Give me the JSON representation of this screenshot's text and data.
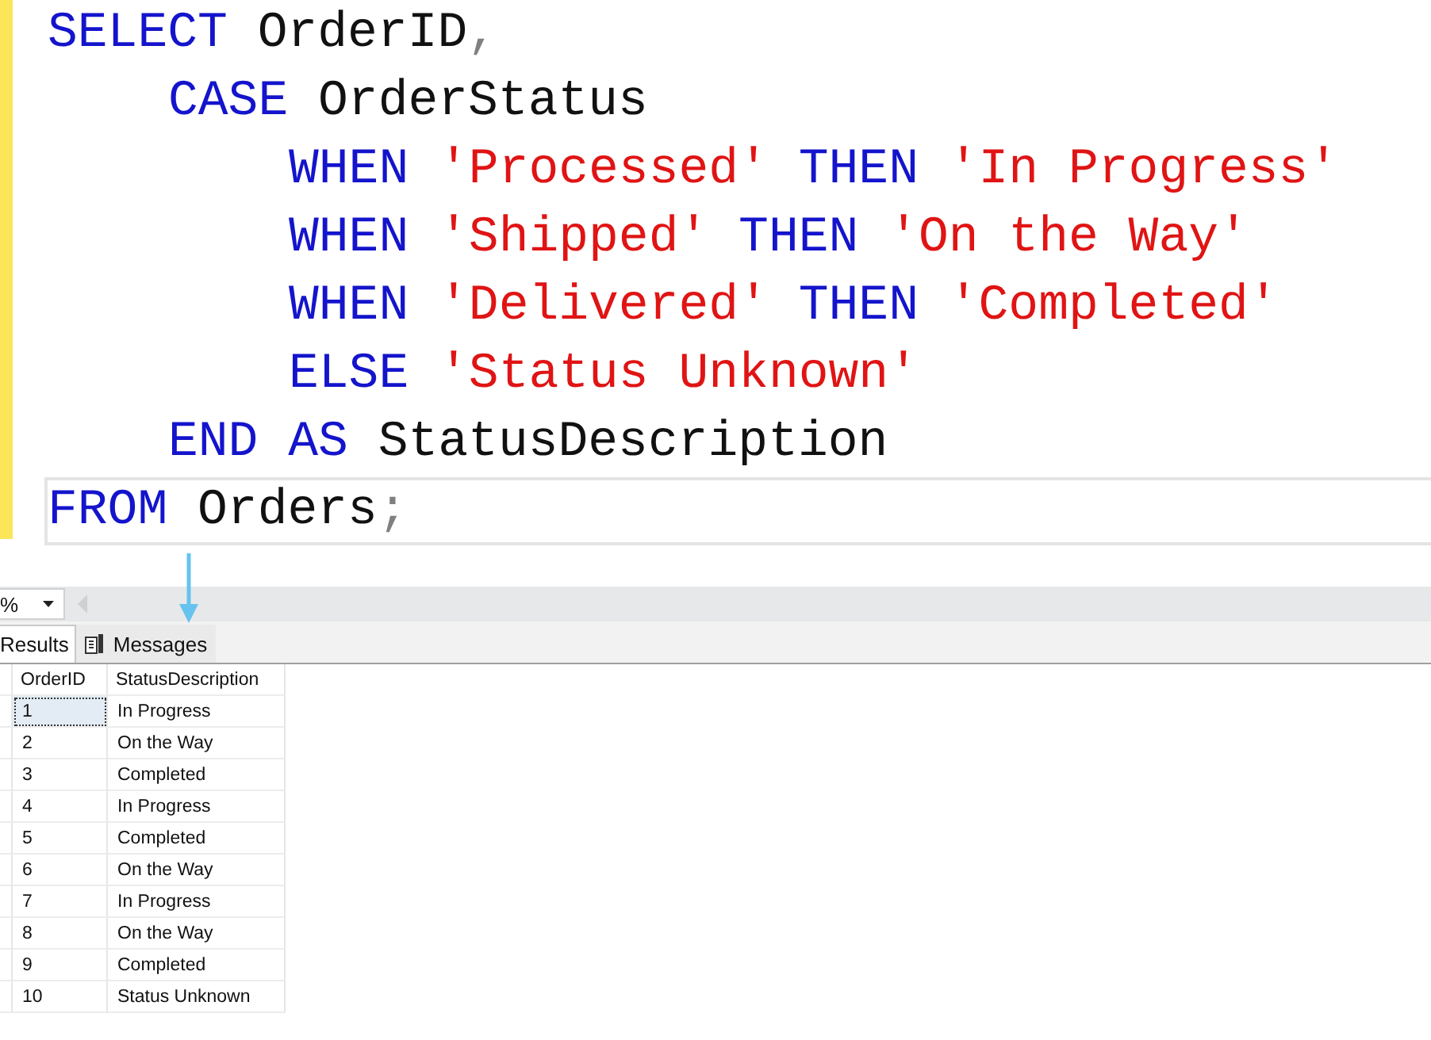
{
  "editor": {
    "lines": [
      {
        "current": false,
        "tokens": [
          {
            "kind": "keyword",
            "text": "SELECT "
          },
          {
            "kind": "plain",
            "text": "OrderID"
          },
          {
            "kind": "punct",
            "text": ","
          }
        ],
        "children": [
          {
            "current": false,
            "tokens": [
              {
                "kind": "keyword",
                "text": "CASE "
              },
              {
                "kind": "plain",
                "text": "OrderStatus"
              }
            ],
            "children": [
              {
                "current": false,
                "tokens": [
                  {
                    "kind": "keyword",
                    "text": "WHEN "
                  },
                  {
                    "kind": "string",
                    "text": "'Processed' "
                  },
                  {
                    "kind": "keyword",
                    "text": "THEN "
                  },
                  {
                    "kind": "string",
                    "text": "'In Progress'"
                  }
                ]
              },
              {
                "current": false,
                "tokens": [
                  {
                    "kind": "keyword",
                    "text": "WHEN "
                  },
                  {
                    "kind": "string",
                    "text": "'Shipped' "
                  },
                  {
                    "kind": "keyword",
                    "text": "THEN "
                  },
                  {
                    "kind": "string",
                    "text": "'On the Way'"
                  }
                ]
              },
              {
                "current": false,
                "tokens": [
                  {
                    "kind": "keyword",
                    "text": "WHEN "
                  },
                  {
                    "kind": "string",
                    "text": "'Delivered' "
                  },
                  {
                    "kind": "keyword",
                    "text": "THEN "
                  },
                  {
                    "kind": "string",
                    "text": "'Completed'"
                  }
                ]
              },
              {
                "current": false,
                "tokens": [
                  {
                    "kind": "keyword",
                    "text": "ELSE "
                  },
                  {
                    "kind": "string",
                    "text": "'Status Unknown'"
                  }
                ]
              }
            ]
          },
          {
            "current": false,
            "tokens": [
              {
                "kind": "keyword",
                "text": "END AS "
              },
              {
                "kind": "plain",
                "text": "StatusDescription"
              }
            ]
          }
        ]
      },
      {
        "current": true,
        "tokens": [
          {
            "kind": "keyword",
            "text": "FROM "
          },
          {
            "kind": "plain",
            "text": "Orders"
          },
          {
            "kind": "punct",
            "text": ";"
          }
        ]
      }
    ]
  },
  "zoom": {
    "value": "%"
  },
  "tabs": [
    {
      "label": "Results",
      "selected": true
    },
    {
      "label": "Messages",
      "selected": false
    }
  ],
  "grid": {
    "columns": [
      "OrderID",
      "StatusDescription"
    ],
    "rows": [
      {
        "selected": true,
        "cells": [
          "1",
          "In Progress"
        ]
      },
      {
        "selected": false,
        "cells": [
          "2",
          "On the Way"
        ]
      },
      {
        "selected": false,
        "cells": [
          "3",
          "Completed"
        ]
      },
      {
        "selected": false,
        "cells": [
          "4",
          "In Progress"
        ]
      },
      {
        "selected": false,
        "cells": [
          "5",
          "Completed"
        ]
      },
      {
        "selected": false,
        "cells": [
          "6",
          "On the Way"
        ]
      },
      {
        "selected": false,
        "cells": [
          "7",
          "In Progress"
        ]
      },
      {
        "selected": false,
        "cells": [
          "8",
          "On the Way"
        ]
      },
      {
        "selected": false,
        "cells": [
          "9",
          "Completed"
        ]
      },
      {
        "selected": false,
        "cells": [
          "10",
          "Status Unknown"
        ]
      }
    ]
  }
}
